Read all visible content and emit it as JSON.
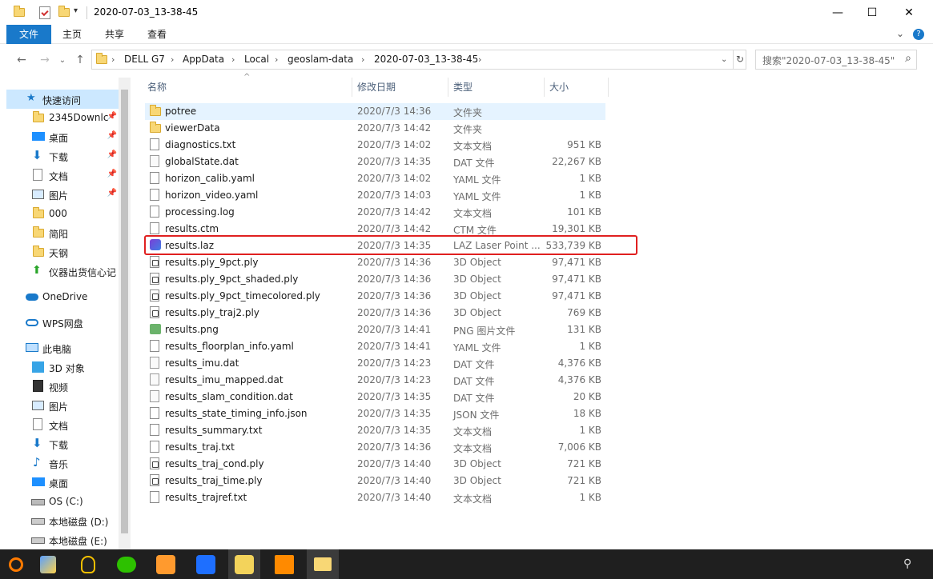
{
  "window": {
    "title": "2020-07-03_13-38-45",
    "controls": {
      "minimize": "—",
      "maximize": "☐",
      "close": "✕"
    }
  },
  "ribbon": {
    "tabs": [
      "文件",
      "主页",
      "共享",
      "查看"
    ],
    "expand": "⌄",
    "help": "?"
  },
  "nav": {
    "back": "←",
    "forward": "→",
    "recent": "⌄",
    "up": "↑",
    "breadcrumb": [
      "DELL G7",
      "AppData",
      "Local",
      "geoslam-data",
      "2020-07-03_13-38-45"
    ],
    "separator": "›",
    "dropdown": "⌄",
    "refresh": "↻",
    "search_placeholder": "搜索\"2020-07-03_13-38-45\"",
    "search_icon": "⌕"
  },
  "sidebar": {
    "quick_access": "快速访问",
    "pinned": [
      "2345Downlc",
      "桌面",
      "下载",
      "文档",
      "图片"
    ],
    "unpinned": [
      "000",
      "简阳",
      "天钢",
      "仪器出货信心记"
    ],
    "onedrive": "OneDrive",
    "wps": "WPS网盘",
    "this_pc": "此电脑",
    "pc_items": [
      "3D 对象",
      "视频",
      "图片",
      "文档",
      "下载",
      "音乐",
      "桌面",
      "OS (C:)",
      "本地磁盘 (D:)",
      "本地磁盘 (E:)"
    ]
  },
  "columns": {
    "name": "名称",
    "date": "修改日期",
    "type": "类型",
    "size": "大小"
  },
  "files": [
    {
      "name": "potree",
      "date": "2020/7/3 14:36",
      "type": "文件夹",
      "size": "",
      "icon": "folder"
    },
    {
      "name": "viewerData",
      "date": "2020/7/3 14:42",
      "type": "文件夹",
      "size": "",
      "icon": "folder"
    },
    {
      "name": "diagnostics.txt",
      "date": "2020/7/3 14:02",
      "type": "文本文档",
      "size": "951 KB",
      "icon": "doc"
    },
    {
      "name": "globalState.dat",
      "date": "2020/7/3 14:35",
      "type": "DAT 文件",
      "size": "22,267 KB",
      "icon": "dat"
    },
    {
      "name": "horizon_calib.yaml",
      "date": "2020/7/3 14:02",
      "type": "YAML 文件",
      "size": "1 KB",
      "icon": "doc"
    },
    {
      "name": "horizon_video.yaml",
      "date": "2020/7/3 14:03",
      "type": "YAML 文件",
      "size": "1 KB",
      "icon": "doc"
    },
    {
      "name": "processing.log",
      "date": "2020/7/3 14:42",
      "type": "文本文档",
      "size": "101 KB",
      "icon": "doc"
    },
    {
      "name": "results.ctm",
      "date": "2020/7/3 14:42",
      "type": "CTM 文件",
      "size": "19,301 KB",
      "icon": "doc"
    },
    {
      "name": "results.laz",
      "date": "2020/7/3 14:35",
      "type": "LAZ Laser Point ...",
      "size": "533,739 KB",
      "icon": "laz"
    },
    {
      "name": "results.ply_9pct.ply",
      "date": "2020/7/3 14:36",
      "type": "3D Object",
      "size": "97,471 KB",
      "icon": "ply"
    },
    {
      "name": "results.ply_9pct_shaded.ply",
      "date": "2020/7/3 14:36",
      "type": "3D Object",
      "size": "97,471 KB",
      "icon": "ply"
    },
    {
      "name": "results.ply_9pct_timecolored.ply",
      "date": "2020/7/3 14:36",
      "type": "3D Object",
      "size": "97,471 KB",
      "icon": "ply"
    },
    {
      "name": "results.ply_traj2.ply",
      "date": "2020/7/3 14:36",
      "type": "3D Object",
      "size": "769 KB",
      "icon": "ply"
    },
    {
      "name": "results.png",
      "date": "2020/7/3 14:41",
      "type": "PNG 图片文件",
      "size": "131 KB",
      "icon": "png"
    },
    {
      "name": "results_floorplan_info.yaml",
      "date": "2020/7/3 14:41",
      "type": "YAML 文件",
      "size": "1 KB",
      "icon": "doc"
    },
    {
      "name": "results_imu.dat",
      "date": "2020/7/3 14:23",
      "type": "DAT 文件",
      "size": "4,376 KB",
      "icon": "dat"
    },
    {
      "name": "results_imu_mapped.dat",
      "date": "2020/7/3 14:23",
      "type": "DAT 文件",
      "size": "4,376 KB",
      "icon": "dat"
    },
    {
      "name": "results_slam_condition.dat",
      "date": "2020/7/3 14:35",
      "type": "DAT 文件",
      "size": "20 KB",
      "icon": "dat"
    },
    {
      "name": "results_state_timing_info.json",
      "date": "2020/7/3 14:35",
      "type": "JSON 文件",
      "size": "18 KB",
      "icon": "doc"
    },
    {
      "name": "results_summary.txt",
      "date": "2020/7/3 14:35",
      "type": "文本文档",
      "size": "1 KB",
      "icon": "doc"
    },
    {
      "name": "results_traj.txt",
      "date": "2020/7/3 14:36",
      "type": "文本文档",
      "size": "7,006 KB",
      "icon": "doc"
    },
    {
      "name": "results_traj_cond.ply",
      "date": "2020/7/3 14:40",
      "type": "3D Object",
      "size": "721 KB",
      "icon": "ply"
    },
    {
      "name": "results_traj_time.ply",
      "date": "2020/7/3 14:40",
      "type": "3D Object",
      "size": "721 KB",
      "icon": "ply"
    },
    {
      "name": "results_trajref.txt",
      "date": "2020/7/3 14:40",
      "type": "文本文档",
      "size": "1 KB",
      "icon": "doc"
    }
  ],
  "colors": {
    "accent": "#1979ca",
    "selection": "#cce8ff",
    "hover": "#e5f3ff",
    "highlight_box": "#e02020",
    "taskbar": "#1f1f1f"
  },
  "taskbar": {
    "items": [
      "search-app-icon",
      "d-app-icon",
      "qq-icon",
      "wechat-icon",
      "browser-icon",
      "wps-icon",
      "viewer-app-icon",
      "geoslam-icon",
      "file-explorer-icon"
    ],
    "tray_icon": "person-icon"
  }
}
